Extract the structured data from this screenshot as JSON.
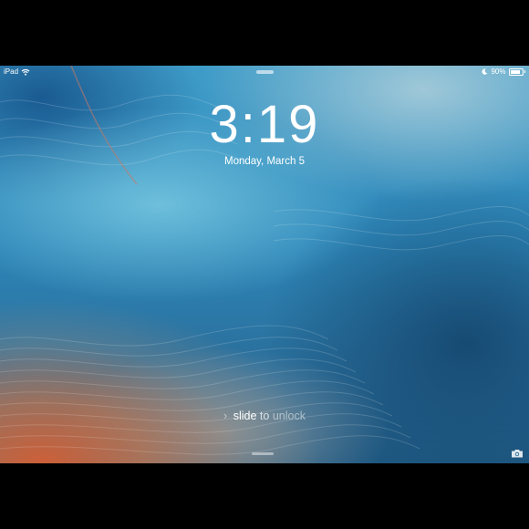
{
  "status_bar": {
    "device": "iPad",
    "battery_text": "90%",
    "battery_level": 0.9,
    "wifi_icon": "wifi-icon",
    "moon_icon": "moon-icon"
  },
  "lockscreen": {
    "time": "3:19",
    "date": "Monday, March 5",
    "slide_word": "slide",
    "slide_to": "to",
    "slide_action": "unlock",
    "chevron_icon": "chevron-right-icon",
    "camera_icon": "camera-icon"
  }
}
